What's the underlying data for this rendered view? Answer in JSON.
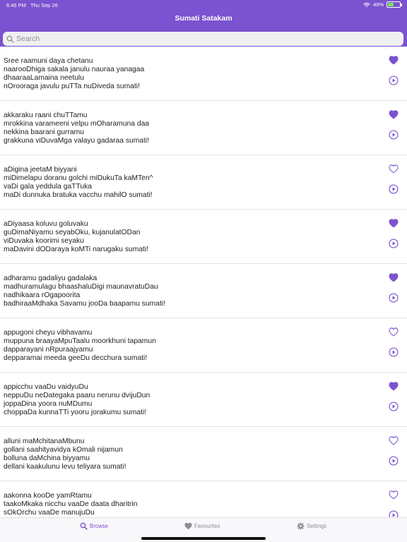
{
  "status_bar": {
    "time": "6:45 PM",
    "date": "Thu Sep 26",
    "battery": "49%",
    "battery_level": 0.49
  },
  "header": {
    "title": "Sumati Satakam"
  },
  "search": {
    "placeholder": "Search"
  },
  "poems": [
    {
      "lines": [
        "Sree raamuni daya chetanu",
        "naarooDhiga sakala janulu nauraa yanagaa",
        "dhaaraaLamaina neetulu",
        "nOrooraga javulu puTTa nuDiveda sumati!"
      ],
      "favourite": true
    },
    {
      "lines": [
        "akkaraku raani chuTTamu",
        "mrokkina varameeni velpu mOharamuna daa",
        "nekkina baarani gurramu",
        "grakkuna viDuvaMga valayu gadaraa sumati!"
      ],
      "favourite": true
    },
    {
      "lines": [
        "aDigina jeetaM biyyani",
        "miDimelapu doranu golchi miDukuTa kaMTen^",
        "vaDi gala yeddula gaTTuka",
        "maDi dunnuka bratuka vacchu mahilO sumati!"
      ],
      "favourite": false
    },
    {
      "lines": [
        "aDiyaasa koluvu goluvaku",
        "guDimaNiyamu seyabOku, kujanulatODan",
        "viDuvaka koorimi seyaku",
        "maDavini dODaraya koMTi narugaku sumati!"
      ],
      "favourite": true
    },
    {
      "lines": [
        "adharamu gadaliyu gadalaka",
        "madhuramulagu bhaashaluDigi maunavratuDau",
        "nadhikaara rOgapoorita",
        "badhiraaMdhaka Savamu jooDa baapamu sumati!"
      ],
      "favourite": true
    },
    {
      "lines": [
        "appugoni cheyu vibhavamu",
        "muppuna braayaMpuTaalu moorkhuni tapamun",
        "dapparayani nRpuraajyamu",
        "depparamai meeda geeDu decchura sumati!"
      ],
      "favourite": false
    },
    {
      "lines": [
        "appicchu vaaDu vaidyuDu",
        "neppuDu neDategaka paaru nerunu dvijuDun",
        "joppaDina yoora nuMDumu",
        "choppaDa kunnaTTi yooru jorakumu sumati!"
      ],
      "favourite": true
    },
    {
      "lines": [
        "alluni maMchitanaMbunu",
        "gollani saahityavidya kOmali nijamun",
        "bolluna daMchina biyyamu",
        "dellani kaakulunu levu teliyara sumati!"
      ],
      "favourite": false
    },
    {
      "lines": [
        "aakonna kooDe yamRtamu",
        "taakoMkaka nicchu vaaDe daata dharitrin",
        "sOkOrchu vaaDe manujuDu",
        ""
      ],
      "favourite": false
    }
  ],
  "tabs": [
    {
      "label": "Browse",
      "icon": "search-icon",
      "active": true
    },
    {
      "label": "Favourites",
      "icon": "heart-icon",
      "active": false
    },
    {
      "label": "Settings",
      "icon": "gear-icon",
      "active": false
    }
  ],
  "colors": {
    "accent": "#7b52cf",
    "inactive": "#8e8e93",
    "battery": "#7ee06b"
  }
}
